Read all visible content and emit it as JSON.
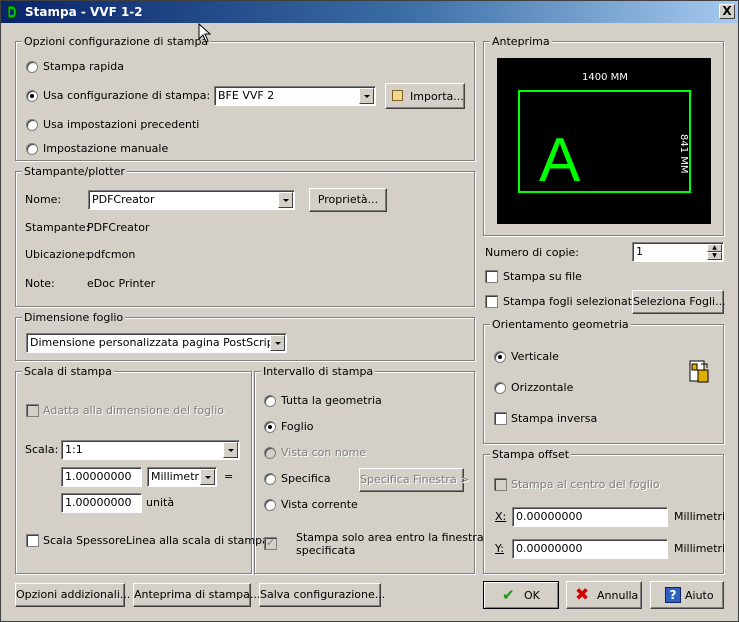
{
  "window": {
    "title": "Stampa - VVF 1-2",
    "close_glyph": "X"
  },
  "config": {
    "legend": "Opzioni configurazione di stampa",
    "quick_label": "Stampa rapida",
    "use_label": "Usa configurazione di stampa:",
    "use_value": "BFE VVF 2",
    "import_label": "Importa...",
    "prev_label": "Usa impostazioni precedenti",
    "manual_label": "Impostazione manuale"
  },
  "printer": {
    "legend": "Stampante/plotter",
    "name_label": "Nome:",
    "name_value": "PDFCreator",
    "props_label": "Proprietà...",
    "printer_label": "Stampante:",
    "printer_value": "PDFCreator",
    "location_label": "Ubicazione:",
    "location_value": "pdfcmon",
    "note_label": "Note:",
    "note_value": "eDoc Printer"
  },
  "paper": {
    "legend": "Dimensione foglio",
    "value": "Dimensione personalizzata pagina PostScript"
  },
  "scale": {
    "legend": "Scala di stampa",
    "fit_label": "Adatta alla dimensione del foglio",
    "scale_label": "Scala:",
    "scale_value": "1:1",
    "value1": "1.00000000",
    "unit_value": "Millimetri",
    "equals": "=",
    "value2": "1.00000000",
    "unit_label": "unità",
    "lineweight_label": "Scala SpessoreLinea alla scala di stampa"
  },
  "range": {
    "legend": "Intervallo di stampa",
    "all_label": "Tutta la geometria",
    "sheet_label": "Foglio",
    "named_label": "Vista con nome",
    "window_label": "Specifica",
    "window_button": "Specifica Finestra >",
    "current_label": "Vista corrente",
    "area_label_1": "Stampa solo area entro la finestra",
    "area_label_2": "specificata"
  },
  "preview": {
    "legend": "Anteprima",
    "width_label": "1400 MM",
    "height_label": "841 MM",
    "letter": "A",
    "frame_color": "#00ff00"
  },
  "copies": {
    "label": "Numero di copie:",
    "value": "1"
  },
  "to_file_label": "Stampa su file",
  "selected_label": "Stampa fogli selezionati",
  "select_sheets_button": "Seleziona Fogli...",
  "orientation": {
    "legend": "Orientamento geometria",
    "portrait_label": "Verticale",
    "landscape_label": "Orizzontale",
    "reverse_label": "Stampa inversa"
  },
  "offset": {
    "legend": "Stampa offset",
    "center_label": "Stampa al centro del foglio",
    "x_label": "X:",
    "x_value": "0.00000000",
    "x_unit": "Millimetri",
    "y_label": "Y:",
    "y_value": "0.00000000",
    "y_unit": "Millimetri"
  },
  "footer": {
    "more_options": "Opzioni addizionali...",
    "preview": "Anteprima di stampa...",
    "save_config": "Salva configurazione...",
    "ok": "OK",
    "cancel": "Annulla",
    "help": "Aiuto"
  }
}
